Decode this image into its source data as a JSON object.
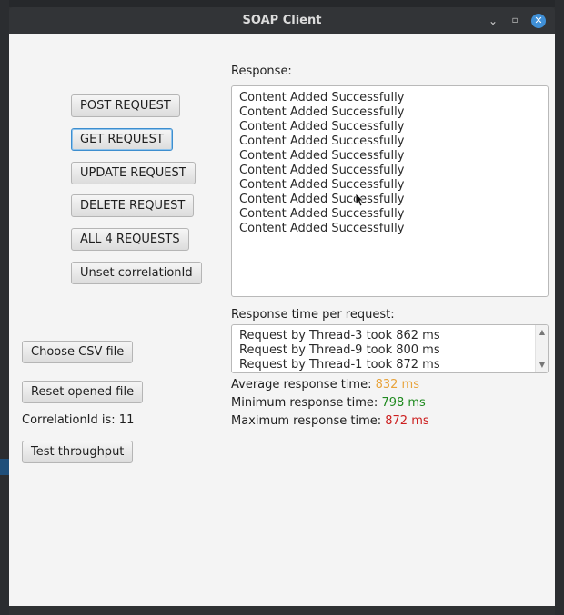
{
  "window": {
    "title": "SOAP Client"
  },
  "buttons": {
    "post": "POST REQUEST",
    "get": "GET REQUEST",
    "update": "UPDATE REQUEST",
    "delete": "DELETE REQUEST",
    "all4": "ALL 4 REQUESTS",
    "unset": "Unset correlationId",
    "choose_csv": "Choose CSV file",
    "reset_file": "Reset opened file",
    "throughput": "Test throughput"
  },
  "correlation": {
    "label": "CorrelationId is: 11"
  },
  "response": {
    "label": "Response:",
    "lines": [
      "Content Added Successfully",
      "Content Added Successfully",
      "Content Added Successfully",
      "Content Added Successfully",
      "Content Added Successfully",
      "Content Added Successfully",
      "Content Added Successfully",
      "Content Added Successfully",
      "Content Added Successfully",
      "Content Added Successfully"
    ]
  },
  "timing": {
    "label": "Response time per request:",
    "lines": [
      "Request by Thread-3 took 862 ms",
      "Request by Thread-9 took 800 ms",
      "Request by Thread-1 took 872 ms"
    ],
    "average_label": "Average response time:",
    "average_value": "832 ms",
    "minimum_label": "Minimum response time:",
    "minimum_value": "798 ms",
    "maximum_label": "Maximum response time:",
    "maximum_value": "872 ms"
  },
  "colors": {
    "average": "#e8a33a",
    "minimum": "#1f8a1f",
    "maximum": "#cc1f1f",
    "focus": "#3d8ecf"
  }
}
